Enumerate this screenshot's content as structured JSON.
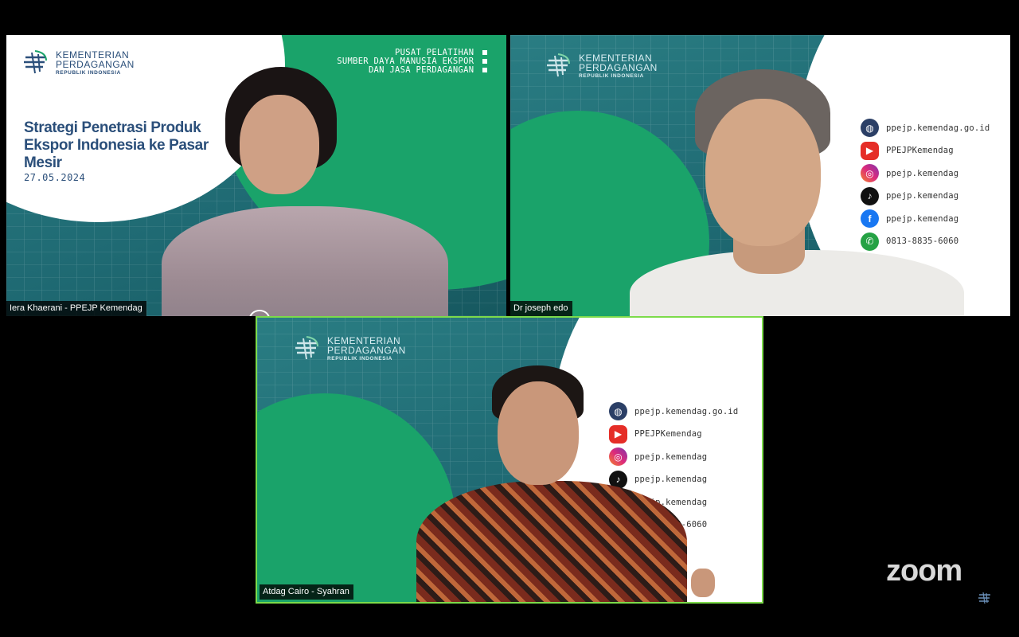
{
  "meeting": {
    "app": "zoom"
  },
  "tiles": [
    {
      "participant": "Iera Khaerani - PPEJP Kemendag",
      "slide": {
        "ministry_line1": "KEMENTERIAN",
        "ministry_line2": "PERDAGANGAN",
        "ministry_line3": "REPUBLIK INDONESIA",
        "unit_line1": "PUSAT PELATIHAN",
        "unit_line2": "SUMBER DAYA MANUSIA EKSPOR",
        "unit_line3": "DAN JASA PERDAGANGAN",
        "title_line1": "Strategi Penetrasi Produk",
        "title_line2": "Ekspor Indonesia ke Pasar",
        "title_line3": "Mesir",
        "date": "27.05.2024"
      }
    },
    {
      "participant": "Dr joseph edo",
      "slide": {
        "ministry_line1": "KEMENTERIAN",
        "ministry_line2": "PERDAGANGAN",
        "ministry_line3": "REPUBLIK INDONESIA"
      },
      "social": [
        {
          "icon": "globe-icon",
          "text": "ppejp.kemendag.go.id"
        },
        {
          "icon": "youtube-icon",
          "text": "PPEJPKemendag"
        },
        {
          "icon": "instagram-icon",
          "text": "ppejp.kemendag"
        },
        {
          "icon": "tiktok-icon",
          "text": "ppejp.kemendag"
        },
        {
          "icon": "facebook-icon",
          "text": "ppejp.kemendag"
        },
        {
          "icon": "whatsapp-icon",
          "text": "0813-8835-6060"
        }
      ]
    },
    {
      "participant": "Atdag Cairo - Syahran",
      "active_speaker": true,
      "slide": {
        "ministry_line1": "KEMENTERIAN",
        "ministry_line2": "PERDAGANGAN",
        "ministry_line3": "REPUBLIK INDONESIA"
      },
      "social": [
        {
          "icon": "globe-icon",
          "text": "ppejp.kemendag.go.id"
        },
        {
          "icon": "youtube-icon",
          "text": "PPEJPKemendag"
        },
        {
          "icon": "instagram-icon",
          "text": "ppejp.kemendag"
        },
        {
          "icon": "tiktok-icon",
          "text": "ppejp.kemendag"
        },
        {
          "icon": "facebook-icon",
          "text": "ppejp.kemendag"
        },
        {
          "icon": "whatsapp-icon",
          "text": "0813-8835-6060"
        }
      ]
    }
  ],
  "colors": {
    "active_speaker_border": "#7cdb4a",
    "brand_green": "#1aa36a",
    "brand_teal": "#1f6a73",
    "brand_navy": "#2b4f7a"
  }
}
